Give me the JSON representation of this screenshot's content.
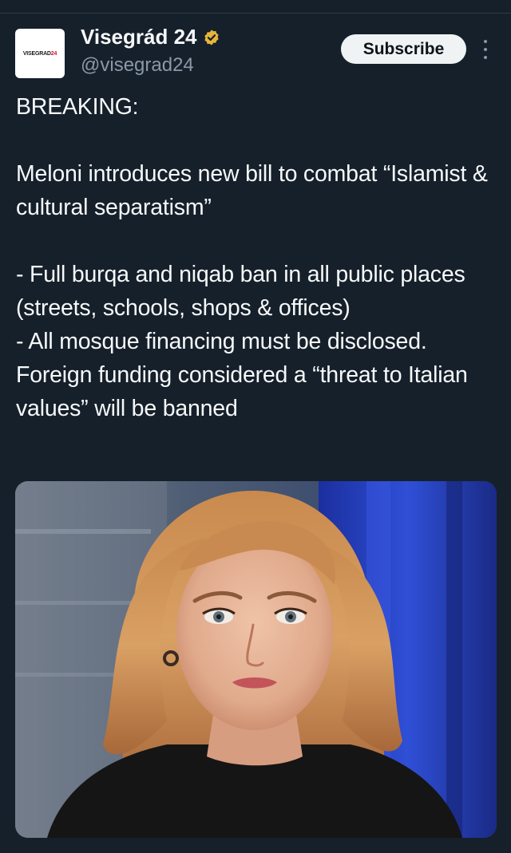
{
  "tweet": {
    "author": {
      "avatar_logo_text": "VISEGRAD",
      "avatar_logo_number": "24",
      "display_name": "Visegrád 24",
      "handle": "@visegrad24",
      "verified": true,
      "verified_color": "#e7b53b"
    },
    "subscribe_label": "Subscribe",
    "body": {
      "line1": "BREAKING:",
      "line2": "Meloni introduces new bill to combat “Islamist & cultural separatism”",
      "line3": "- Full burqa and niqab ban in all public places (streets, schools, shops & offices)",
      "line4": "- All mosque financing must be disclosed. Foreign funding considered a “threat to Italian values” will be banned"
    },
    "media": {
      "type": "photo",
      "alt_subject": "portrait-photo"
    }
  },
  "colors": {
    "background": "#15202b",
    "text": "#f7f9f9",
    "secondary_text": "#8b98a5",
    "subscribe_bg": "#eff3f4"
  }
}
